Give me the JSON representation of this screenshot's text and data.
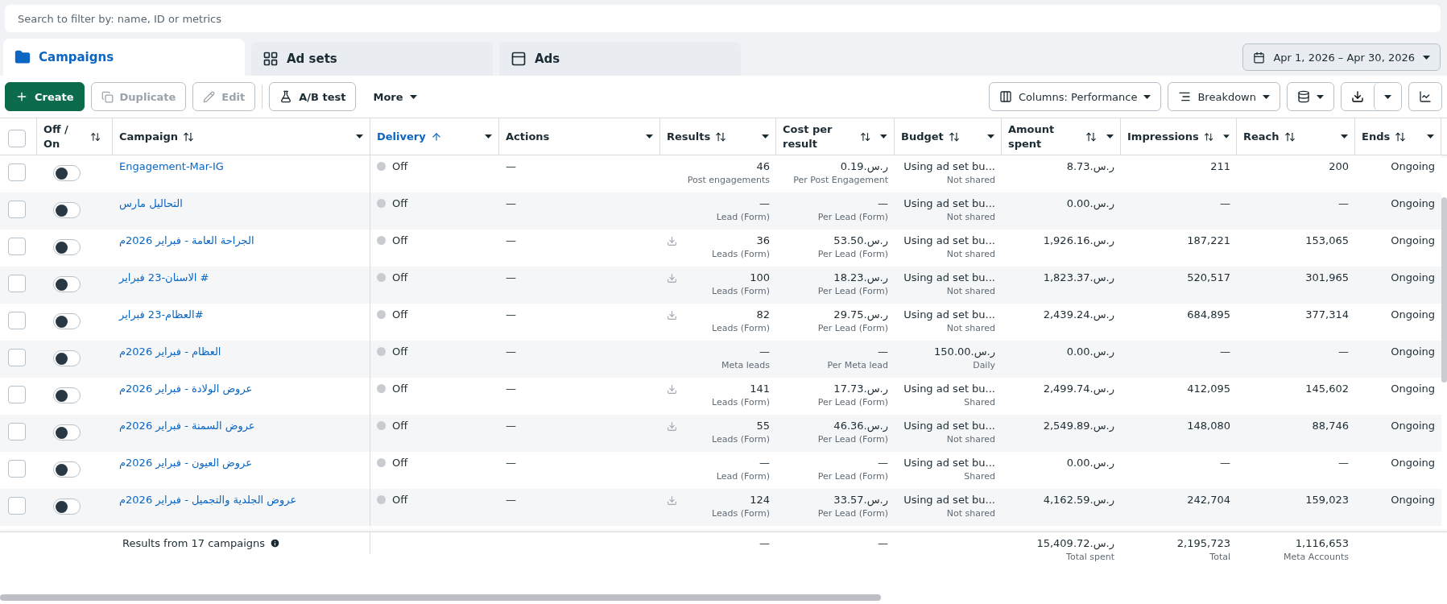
{
  "search": {
    "placeholder": "Search to filter by: name, ID or metrics"
  },
  "tabs": [
    {
      "label": "Campaigns",
      "selected": true
    },
    {
      "label": "Ad sets",
      "selected": false
    },
    {
      "label": "Ads",
      "selected": false
    }
  ],
  "date_range": "Apr 1, 2026 – Apr 30, 2026",
  "toolbar": {
    "create": "Create",
    "duplicate": {
      "label": "Duplicate",
      "disabled": true
    },
    "edit": {
      "label": "Edit",
      "disabled": true
    },
    "ab_test": "A/B test",
    "more": "More",
    "columns": "Columns: Performance",
    "breakdown": "Breakdown"
  },
  "table": {
    "select_all_checked": false,
    "columns": [
      {
        "label": "Off / On",
        "sortable": true,
        "active": false,
        "menu": false
      },
      {
        "label": "Campaign",
        "sortable": true,
        "active": false,
        "menu": true
      },
      {
        "label": "Delivery",
        "sortable": true,
        "active": true,
        "menu": true
      },
      {
        "label": "Actions",
        "sortable": false,
        "active": false,
        "menu": true
      },
      {
        "label": "Results",
        "sortable": true,
        "active": false,
        "menu": true
      },
      {
        "label": "Cost per result",
        "sortable": true,
        "active": false,
        "menu": true
      },
      {
        "label": "Budget",
        "sortable": true,
        "active": false,
        "menu": true
      },
      {
        "label": "Amount spent",
        "sortable": true,
        "active": false,
        "menu": true
      },
      {
        "label": "Impressions",
        "sortable": true,
        "active": false,
        "menu": true
      },
      {
        "label": "Reach",
        "sortable": true,
        "active": false,
        "menu": true
      },
      {
        "label": "Ends",
        "sortable": true,
        "active": false,
        "menu": true
      }
    ],
    "rows": [
      {
        "checked": false,
        "on": false,
        "campaign": "Engagement-Mar-IG",
        "delivery": "Off",
        "actions": "—",
        "download": false,
        "results": "46",
        "results_sub": "Post engagements",
        "cost": "ر.س.0.19",
        "cost_sub": "Per Post Engagement",
        "budget": "Using ad set bu...",
        "budget_sub": "Not shared",
        "spent": "ر.س.8.73",
        "impressions": "211",
        "reach": "200",
        "ends": "Ongoing"
      },
      {
        "checked": false,
        "on": false,
        "campaign": "التحاليل مارس",
        "delivery": "Off",
        "actions": "—",
        "download": false,
        "results": "—",
        "results_sub": "Lead (Form)",
        "cost": "—",
        "cost_sub": "Per Lead (Form)",
        "budget": "Using ad set bu...",
        "budget_sub": "Not shared",
        "spent": "ر.س.0.00",
        "impressions": "—",
        "reach": "—",
        "ends": "Ongoing"
      },
      {
        "checked": false,
        "on": false,
        "campaign": "الجراحة العامة - فبراير 2026م",
        "delivery": "Off",
        "actions": "—",
        "download": true,
        "results": "36",
        "results_sub": "Leads (Form)",
        "cost": "ر.س.53.50",
        "cost_sub": "Per Lead (Form)",
        "budget": "Using ad set bu...",
        "budget_sub": "Not shared",
        "spent": "ر.س.1,926.16",
        "impressions": "187,221",
        "reach": "153,065",
        "ends": "Ongoing"
      },
      {
        "checked": false,
        "on": false,
        "campaign": "الاسنان-23 فبراير #",
        "delivery": "Off",
        "actions": "—",
        "download": true,
        "results": "100",
        "results_sub": "Leads (Form)",
        "cost": "ر.س.18.23",
        "cost_sub": "Per Lead (Form)",
        "budget": "Using ad set bu...",
        "budget_sub": "Not shared",
        "spent": "ر.س.1,823.37",
        "impressions": "520,517",
        "reach": "301,965",
        "ends": "Ongoing"
      },
      {
        "checked": false,
        "on": false,
        "campaign": "العظام-23 فبراير#",
        "delivery": "Off",
        "actions": "—",
        "download": true,
        "results": "82",
        "results_sub": "Leads (Form)",
        "cost": "ر.س.29.75",
        "cost_sub": "Per Lead (Form)",
        "budget": "Using ad set bu...",
        "budget_sub": "Not shared",
        "spent": "ر.س.2,439.24",
        "impressions": "684,895",
        "reach": "377,314",
        "ends": "Ongoing"
      },
      {
        "checked": false,
        "on": false,
        "campaign": "العظام - فبراير 2026م",
        "delivery": "Off",
        "actions": "—",
        "download": false,
        "results": "—",
        "results_sub": "Meta leads",
        "cost": "—",
        "cost_sub": "Per Meta lead",
        "budget": "ر.س.150.00",
        "budget_sub": "Daily",
        "spent": "ر.س.0.00",
        "impressions": "—",
        "reach": "—",
        "ends": "Ongoing"
      },
      {
        "checked": false,
        "on": false,
        "campaign": "عروض الولادة - فبراير 2026م",
        "delivery": "Off",
        "actions": "—",
        "download": true,
        "results": "141",
        "results_sub": "Leads (Form)",
        "cost": "ر.س.17.73",
        "cost_sub": "Per Lead (Form)",
        "budget": "Using ad set bu...",
        "budget_sub": "Shared",
        "spent": "ر.س.2,499.74",
        "impressions": "412,095",
        "reach": "145,602",
        "ends": "Ongoing"
      },
      {
        "checked": false,
        "on": false,
        "campaign": "عروض السمنة - فبراير 2026م",
        "delivery": "Off",
        "actions": "—",
        "download": true,
        "results": "55",
        "results_sub": "Leads (Form)",
        "cost": "ر.س.46.36",
        "cost_sub": "Per Lead (Form)",
        "budget": "Using ad set bu...",
        "budget_sub": "Not shared",
        "spent": "ر.س.2,549.89",
        "impressions": "148,080",
        "reach": "88,746",
        "ends": "Ongoing"
      },
      {
        "checked": false,
        "on": false,
        "campaign": "عروض العيون - فبراير 2026م",
        "delivery": "Off",
        "actions": "—",
        "download": false,
        "results": "—",
        "results_sub": "Lead (Form)",
        "cost": "—",
        "cost_sub": "Per Lead (Form)",
        "budget": "Using ad set bu...",
        "budget_sub": "Shared",
        "spent": "ر.س.0.00",
        "impressions": "—",
        "reach": "—",
        "ends": "Ongoing"
      },
      {
        "checked": false,
        "on": false,
        "campaign": "عروض الجلدية والتجميل - فبراير 2026م",
        "delivery": "Off",
        "actions": "—",
        "download": true,
        "results": "124",
        "results_sub": "Leads (Form)",
        "cost": "ر.س.33.57",
        "cost_sub": "Per Lead (Form)",
        "budget": "Using ad set bu...",
        "budget_sub": "Not shared",
        "spent": "ر.س.4,162.59",
        "impressions": "242,704",
        "reach": "159,023",
        "ends": "Ongoing"
      }
    ]
  },
  "footer": {
    "label": "Results from 17 campaigns",
    "results": "—",
    "cost": "—",
    "spent": "ر.س.15,409.72",
    "spent_sub": "Total spent",
    "impressions": "2,195,723",
    "impressions_sub": "Total",
    "reach": "1,116,653",
    "reach_sub": "Meta Accounts"
  }
}
